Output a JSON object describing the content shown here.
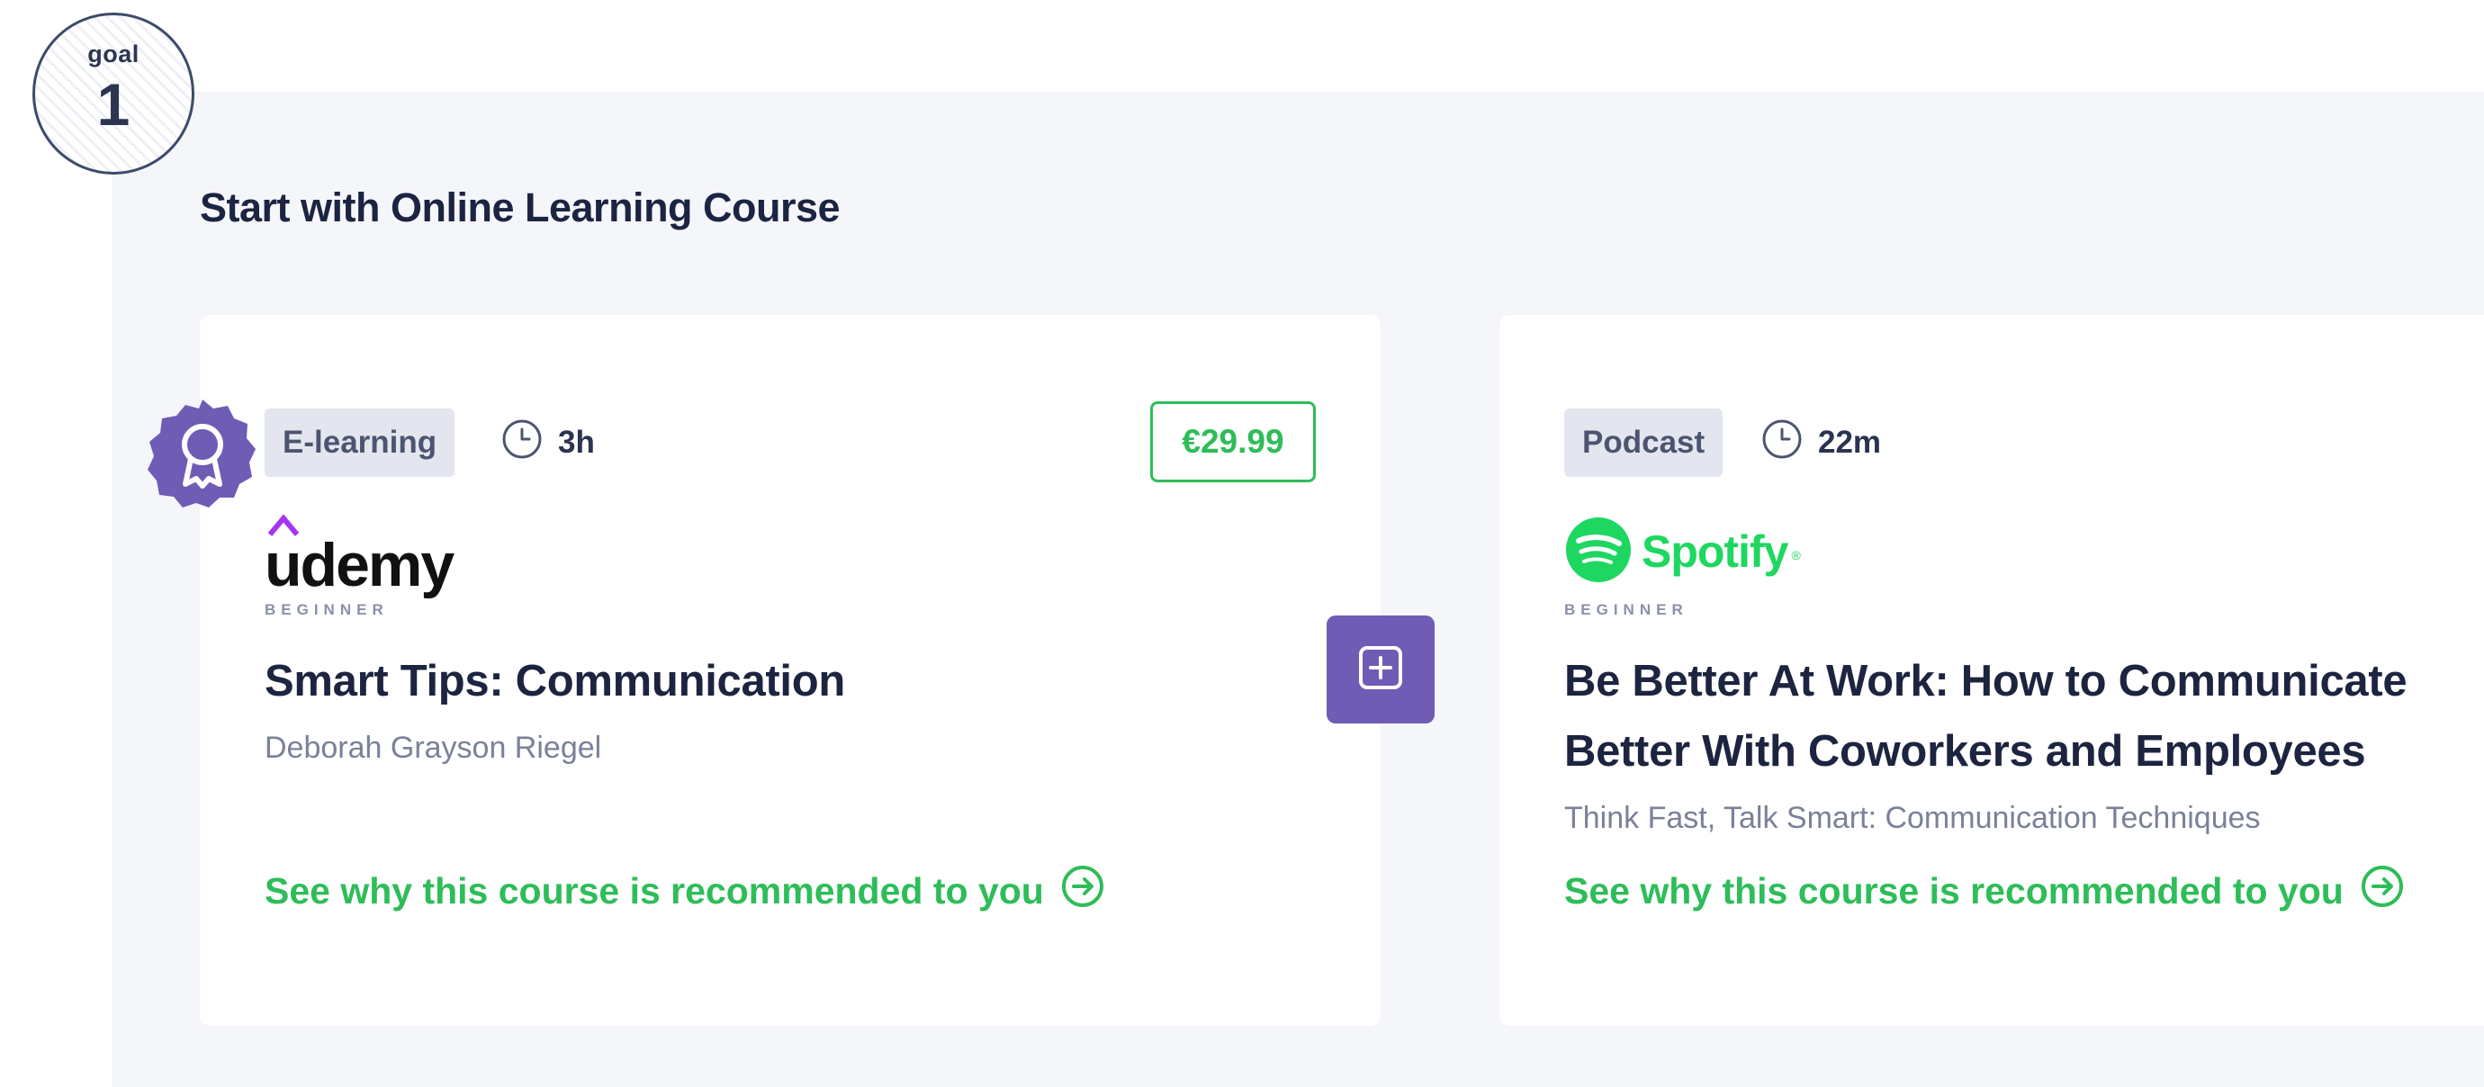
{
  "goal": {
    "label": "goal",
    "number": "1"
  },
  "section": {
    "title": "Start with Online Learning Course"
  },
  "colors": {
    "accent_green": "#2ebd59",
    "accent_purple": "#6f5cb5",
    "spotify_green": "#1ed760",
    "udemy_purple": "#a435f0"
  },
  "cards": [
    {
      "type": "E-learning",
      "duration": "3h",
      "price": "€29.99",
      "provider": "udemy",
      "level": "BEGINNER",
      "title": "Smart Tips: Communication",
      "author": "Deborah Grayson Riegel",
      "recommend_link": "See why this course is recommended to you",
      "icons": [
        "award-icon",
        "clock-icon",
        "arrow-right-circle-icon"
      ]
    },
    {
      "type": "Podcast",
      "duration": "22m",
      "provider": "Spotify",
      "provider_mark": "®",
      "level": "BEGINNER",
      "title_lines": [
        "Be Better At Work: How to Communicate",
        "Better With Coworkers and Employees"
      ],
      "author": "Think Fast, Talk Smart: Communication Techniques",
      "recommend_link": "See why this course is recommended to you",
      "icons": [
        "clock-icon",
        "arrow-right-circle-icon"
      ]
    }
  ],
  "add_button": {
    "icon": "plus-square-icon"
  }
}
